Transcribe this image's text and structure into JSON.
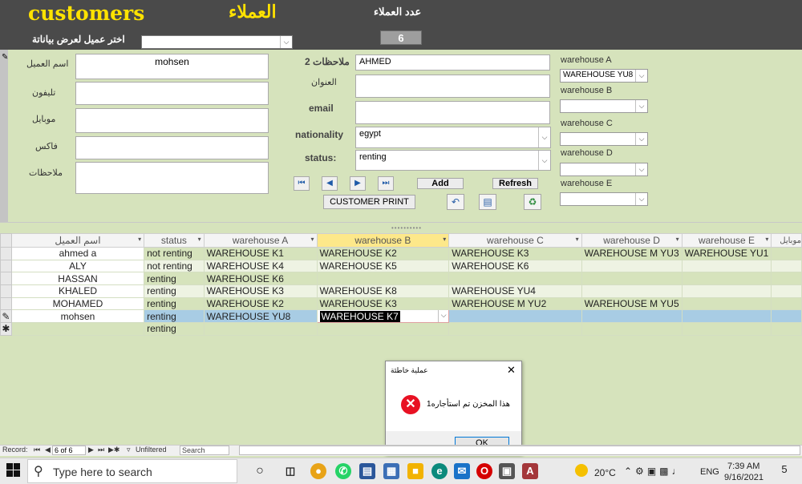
{
  "header": {
    "title_en": "customers",
    "title_ar": "العملاء",
    "count_label": "عدد العملاء",
    "count_value": "6",
    "choose_label": "اختر عميل لعرض بياناتة",
    "choose_value": ""
  },
  "form": {
    "labels": {
      "name": "اسم العميل",
      "phone": "تليفون",
      "mobile": "موبايل",
      "fax": "فاكس",
      "notes": "ملاحظات",
      "notes2": "ملاحظات 2",
      "address": "العنوان",
      "email": "email",
      "nationality": "nationality",
      "status": "status:",
      "wh_a": "warehouse A",
      "wh_b": "warehouse B",
      "wh_c": "warehouse C",
      "wh_d": "warehouse D",
      "wh_e": "warehouse E"
    },
    "values": {
      "name": "mohsen",
      "phone": "",
      "mobile": "",
      "fax": "",
      "notes": "",
      "notes2": "AHMED",
      "address": "",
      "email": "",
      "nationality": "egypt",
      "status": "renting",
      "wh_a": "WAREHOUSE YU8",
      "wh_b": "",
      "wh_c": "",
      "wh_d": "",
      "wh_e": ""
    },
    "buttons": {
      "add": "Add",
      "refresh": "Refresh",
      "print": "CUSTOMER PRINT"
    },
    "nav_icons": [
      "first-record-icon",
      "previous-record-icon",
      "next-record-icon",
      "last-record-icon"
    ]
  },
  "grid": {
    "columns": [
      "اسم العميل",
      "status",
      "warehouse A",
      "warehouse B",
      "warehouse C",
      "warehouse D",
      "warehouse E",
      "موبايل"
    ],
    "rows": [
      [
        "ahmed a",
        "not renting",
        "WAREHOUSE K1",
        "WAREHOUSE K2",
        "WAREHOUSE K3",
        "WAREHOUSE M YU3",
        "WAREHOUSE YU1",
        ""
      ],
      [
        "ALY",
        "not renting",
        "WAREHOUSE K4",
        "WAREHOUSE K5",
        "WAREHOUSE K6",
        "",
        "",
        ""
      ],
      [
        "HASSAN",
        "renting",
        "WAREHOUSE K6",
        "",
        "",
        "",
        "",
        ""
      ],
      [
        "KHALED",
        "renting",
        "WAREHOUSE K3",
        "WAREHOUSE K8",
        "WAREHOUSE YU4",
        "",
        "",
        ""
      ],
      [
        "MOHAMED",
        "renting",
        "WAREHOUSE K2",
        "WAREHOUSE K3",
        "WAREHOUSE M YU2",
        "WAREHOUSE M YU5",
        "",
        ""
      ],
      [
        "mohsen",
        "renting",
        "WAREHOUSE YU8",
        "WAREHOUSE K7",
        "",
        "",
        "",
        ""
      ],
      [
        "",
        "renting",
        "",
        "",
        "",
        "",
        "",
        ""
      ]
    ]
  },
  "dialog": {
    "title": "عملية خاطئة",
    "message": "هذا المخزن تم استأجاره1",
    "ok": "OK"
  },
  "navbar": {
    "record_label": "Record:",
    "record_value": "6 of 6",
    "filter": "Unfiltered",
    "search": "Search"
  },
  "taskbar": {
    "search_placeholder": "Type here to search",
    "temp": "20°C",
    "lang": "ENG",
    "time": "7:39 AM",
    "date": "9/16/2021",
    "notif_count": "5"
  }
}
